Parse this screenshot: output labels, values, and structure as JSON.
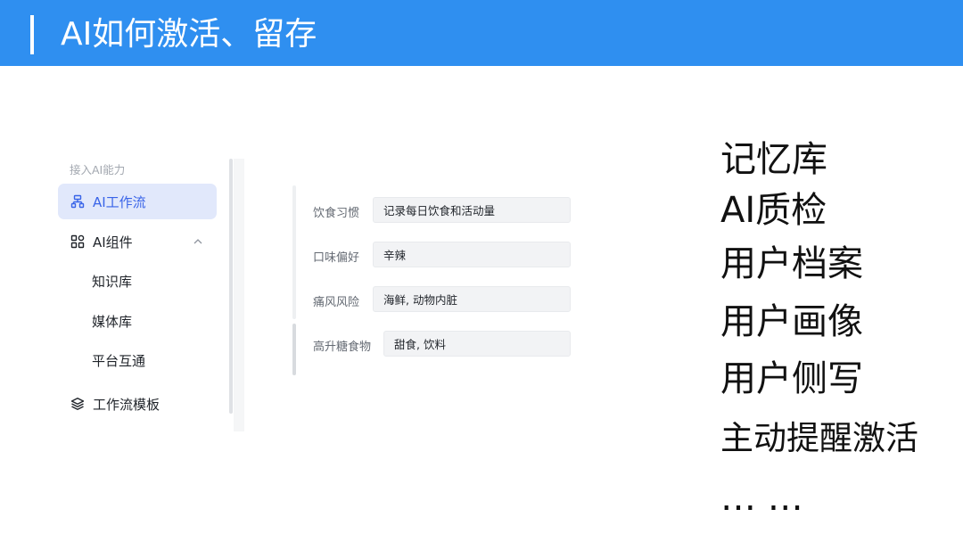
{
  "slide": {
    "title": "AI如何激活、留存",
    "accent_color": "#2f8ff0"
  },
  "sidebar": {
    "section_label": "接入AI能力",
    "active_color": "#3964e8",
    "items": [
      {
        "label": "AI工作流",
        "icon": "workflow-icon",
        "active": true
      },
      {
        "label": "AI组件",
        "icon": "components-icon",
        "expanded": true
      },
      {
        "label": "知识库"
      },
      {
        "label": "媒体库"
      },
      {
        "label": "平台互通"
      },
      {
        "label": "工作流模板",
        "icon": "layers-icon"
      }
    ]
  },
  "profile_form": {
    "fields": [
      {
        "label": "饮食习惯",
        "value": "记录每日饮食和活动量"
      },
      {
        "label": "口味偏好",
        "value": "辛辣"
      },
      {
        "label": "痛风风险",
        "value": "海鲜, 动物内脏"
      },
      {
        "label": "高升糖食物",
        "value": "甜食, 饮料"
      }
    ]
  },
  "features": [
    "记忆库",
    "AI质检",
    "用户档案",
    "用户画像",
    "用户侧写",
    "主动提醒激活",
    "…   …"
  ]
}
